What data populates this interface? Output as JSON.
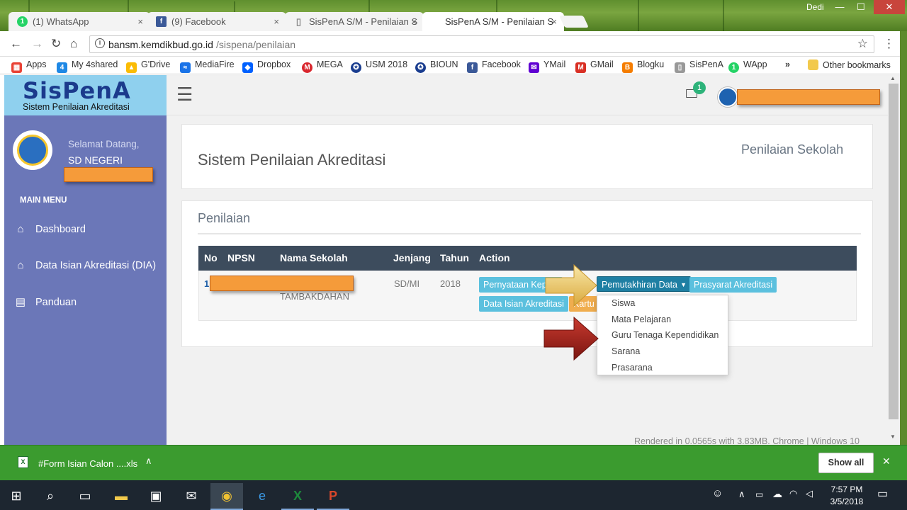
{
  "window": {
    "user": "Dedi",
    "minimize": "—",
    "maximize": "☐",
    "close": "✕"
  },
  "tabs": [
    {
      "label": "(1) WhatsApp",
      "icon": "1",
      "icon_color": "#25d366"
    },
    {
      "label": "(9) Facebook",
      "icon": "f",
      "icon_color": "#3b5998"
    },
    {
      "label": "SisPenA S/M - Penilaian S",
      "icon": "▯",
      "icon_color": "#888"
    },
    {
      "label": "SisPenA S/M - Penilaian S",
      "icon": "",
      "icon_color": "#fff"
    }
  ],
  "tab_close": "×",
  "address": {
    "host": "bansm.kemdikbud.go.id",
    "path": "/sispena/penilaian",
    "star": "☆",
    "menu": "⋮"
  },
  "nav_icons": {
    "back": "←",
    "forward": "→",
    "reload": "↻",
    "home": "⌂"
  },
  "bookmarks": [
    {
      "label": "Apps",
      "color": "#e94235",
      "glyph": "▦"
    },
    {
      "label": "My 4shared",
      "color": "#1e88e5",
      "glyph": "4"
    },
    {
      "label": "G'Drive",
      "color": "#fbbc04",
      "glyph": "▲"
    },
    {
      "label": "MediaFire",
      "color": "#1a73e8",
      "glyph": "≈"
    },
    {
      "label": "Dropbox",
      "color": "#0061ff",
      "glyph": "◆"
    },
    {
      "label": "MEGA",
      "color": "#d9272e",
      "glyph": "M"
    },
    {
      "label": "USM 2018",
      "color": "#1a3d8f",
      "glyph": "✪"
    },
    {
      "label": "BIOUN",
      "color": "#1a3d8f",
      "glyph": "✪"
    },
    {
      "label": "Facebook",
      "color": "#3b5998",
      "glyph": "f"
    },
    {
      "label": "YMail",
      "color": "#6001d2",
      "glyph": "✉"
    },
    {
      "label": "GMail",
      "color": "#d93025",
      "glyph": "M"
    },
    {
      "label": "Blogku",
      "color": "#f57d00",
      "glyph": "B"
    },
    {
      "label": "SisPenA",
      "color": "#999",
      "glyph": "▯"
    },
    {
      "label": "WApp",
      "color": "#25d366",
      "glyph": "1"
    }
  ],
  "bookmarks_more": "»",
  "other_bookmarks": "Other bookmarks",
  "logo": {
    "title": "SisPenA",
    "subtitle": "Sistem Penilaian Akreditasi"
  },
  "topnav": {
    "hamburger": "☰",
    "mail_badge": "1"
  },
  "sidebar": {
    "welcome": "Selamat Datang,",
    "school": "SD NEGERI",
    "main_menu": "MAIN MENU",
    "items": [
      {
        "label": "Dashboard",
        "icon": "⌂"
      },
      {
        "label": "Data Isian Akreditasi (DIA)",
        "icon": "⌂"
      },
      {
        "label": "Panduan",
        "icon": "▤"
      }
    ]
  },
  "header_panel": {
    "title": "Sistem Penilaian Akreditasi",
    "right": "Penilaian Sekolah"
  },
  "content": {
    "section_title": "Penilaian",
    "columns": [
      "No",
      "NPSN",
      "Nama Sekolah",
      "Jenjang",
      "Tahun",
      "Action"
    ],
    "row": {
      "no": "1",
      "nama_sekolah_suffix": "TAMBAKDAHAN",
      "jenjang": "SD/MI",
      "tahun": "2018"
    },
    "buttons": {
      "pernyataan": "Pernyataan Kepala",
      "pemutakhiran": "Pemutakhiran Data",
      "prasyarat": "Prasyarat Akreditasi",
      "data_isian": "Data Isian Akreditasi",
      "kartu": "Kartu"
    },
    "dropdown": [
      "Siswa",
      "Mata Pelajaran",
      "Guru Tenaga Kependidikan",
      "Sarana",
      "Prasarana"
    ],
    "footer": "Rendered in 0.0565s with 3.83MB. Chrome | Windows 10"
  },
  "download": {
    "filename": "#Form Isian Calon ....xls",
    "show_all": "Show all",
    "close": "✕",
    "chevron": "∧"
  },
  "taskbar": {
    "time": "7:57 PM",
    "date": "3/5/2018"
  }
}
